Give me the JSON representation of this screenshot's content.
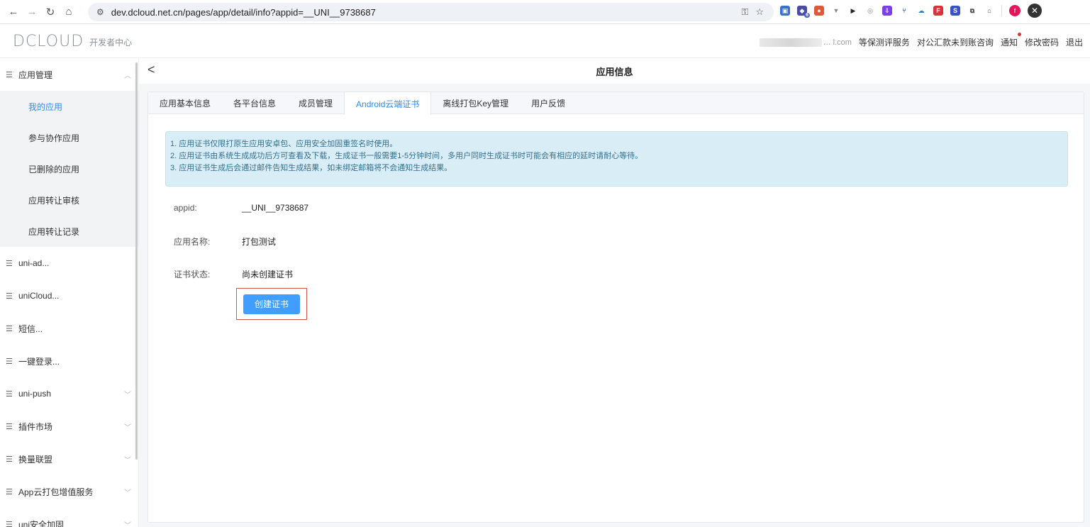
{
  "browser": {
    "url": "dev.dcloud.net.cn/pages/app/detail/info?appid=__UNI__9738687",
    "profile_initial": "f",
    "ext_badge": "6"
  },
  "header": {
    "logo": "DCLOUD",
    "logo_sub": "开发者中心",
    "user_suffix": "… l.com",
    "links": [
      "等保测评服务",
      "对公汇款未到账咨询",
      "通知",
      "修改密码",
      "退出"
    ]
  },
  "sidebar": {
    "app_manage": "应用管理",
    "sub_items": [
      "我的应用",
      "参与协作应用",
      "已删除的应用",
      "应用转让审核",
      "应用转让记录"
    ],
    "groups": [
      {
        "label": "uni-ad...",
        "chev": false
      },
      {
        "label": "uniCloud...",
        "chev": false
      },
      {
        "label": "短信...",
        "chev": false
      },
      {
        "label": "一键登录...",
        "chev": false
      },
      {
        "label": "uni-push",
        "chev": true
      },
      {
        "label": "插件市场",
        "chev": true
      },
      {
        "label": "换量联盟",
        "chev": true
      },
      {
        "label": "App云打包增值服务",
        "chev": true
      },
      {
        "label": "uni安全加固",
        "chev": true
      }
    ]
  },
  "main": {
    "title": "应用信息",
    "tabs": [
      "应用基本信息",
      "各平台信息",
      "成员管理",
      "Android云端证书",
      "离线打包Key管理",
      "用户反馈"
    ],
    "active_tab": 3,
    "alert_lines": [
      "1. 应用证书仅限打原生应用安卓包、应用安全加固重签名时使用。",
      "2. 应用证书由系统生成成功后方可查看及下载，生成证书一般需要1-5分钟时间，多用户同时生成证书时可能会有相应的延时请耐心等待。",
      "3. 应用证书生成后会通过邮件告知生成结果，如未绑定邮箱将不会通知生成结果。"
    ],
    "fields": {
      "appid_label": "appid:",
      "appid_value": "__UNI__9738687",
      "name_label": "应用名称:",
      "name_value": "打包测试",
      "status_label": "证书状态:",
      "status_value": "尚未创建证书"
    },
    "create_button": "创建证书"
  }
}
